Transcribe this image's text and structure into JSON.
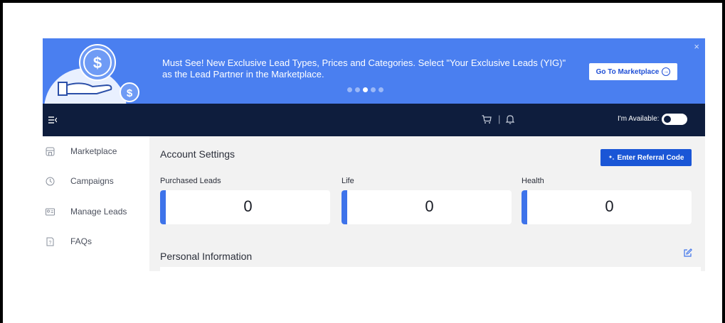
{
  "banner": {
    "message": "Must See! New Exclusive Lead Types, Prices and Categories. Select \"Your Exclusive Leads (YIG)\" as the Lead Partner in the Marketplace.",
    "button_label": "Go To Marketplace",
    "close_icon": "×",
    "slide_count": 5,
    "active_slide": 3,
    "background_color": "#4a7ff0"
  },
  "navbar": {
    "menu_icon": "menu-collapse-icon",
    "cart_icon": "cart-icon",
    "separator": "|",
    "bell_icon": "bell-icon",
    "availability_label": "I'm Available:",
    "available": false,
    "background_color": "#0e1d3d"
  },
  "sidebar": {
    "items": [
      {
        "label": "Marketplace",
        "icon": "store-icon"
      },
      {
        "label": "Campaigns",
        "icon": "clock-icon"
      },
      {
        "label": "Manage Leads",
        "icon": "contact-card-icon"
      },
      {
        "label": "FAQs",
        "icon": "question-doc-icon"
      }
    ]
  },
  "main": {
    "title": "Account Settings",
    "referral_button_label": "Enter Referral Code",
    "stats": [
      {
        "label": "Purchased Leads",
        "value": "0"
      },
      {
        "label": "Life",
        "value": "0"
      },
      {
        "label": "Health",
        "value": "0"
      }
    ],
    "personal_info_title": "Personal Information",
    "accent_color": "#3e73ea"
  }
}
